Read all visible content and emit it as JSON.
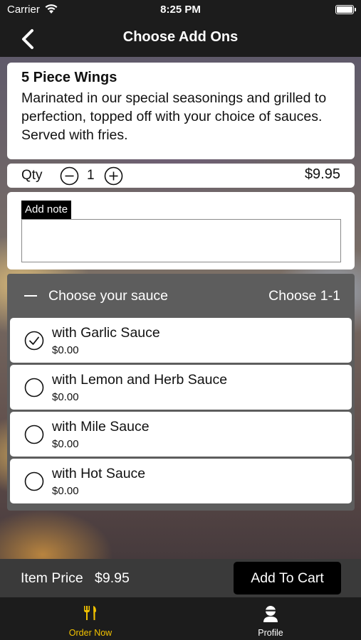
{
  "status_bar": {
    "carrier": "Carrier",
    "time": "8:25 PM",
    "battery_level": 1.0
  },
  "nav": {
    "title": "Choose Add Ons",
    "back_icon": "chevron-left-icon"
  },
  "item": {
    "name": "5 Piece Wings",
    "description": "Marinated in our special seasonings and grilled to perfection, topped off with your choice of sauces. Served with fries."
  },
  "quantity": {
    "label": "Qty",
    "value": "1",
    "price": "$9.95"
  },
  "note": {
    "label": "Add note",
    "value": ""
  },
  "sauce_group": {
    "title": "Choose your sauce",
    "choose_text": "Choose 1-1",
    "options": [
      {
        "name": "with Garlic Sauce",
        "price": "$0.00",
        "selected": true
      },
      {
        "name": "with Lemon and Herb Sauce",
        "price": "$0.00",
        "selected": false
      },
      {
        "name": "with Mile Sauce",
        "price": "$0.00",
        "selected": false
      },
      {
        "name": "with Hot Sauce",
        "price": "$0.00",
        "selected": false
      }
    ]
  },
  "footer": {
    "item_price_label": "Item Price",
    "item_price_value": "$9.95",
    "add_to_cart": "Add To Cart"
  },
  "tabs": [
    {
      "label": "Order Now",
      "icon": "cutlery-icon",
      "active": true,
      "color": "#f2c200"
    },
    {
      "label": "Profile",
      "icon": "user-icon",
      "active": false,
      "color": "#ffffff"
    }
  ]
}
